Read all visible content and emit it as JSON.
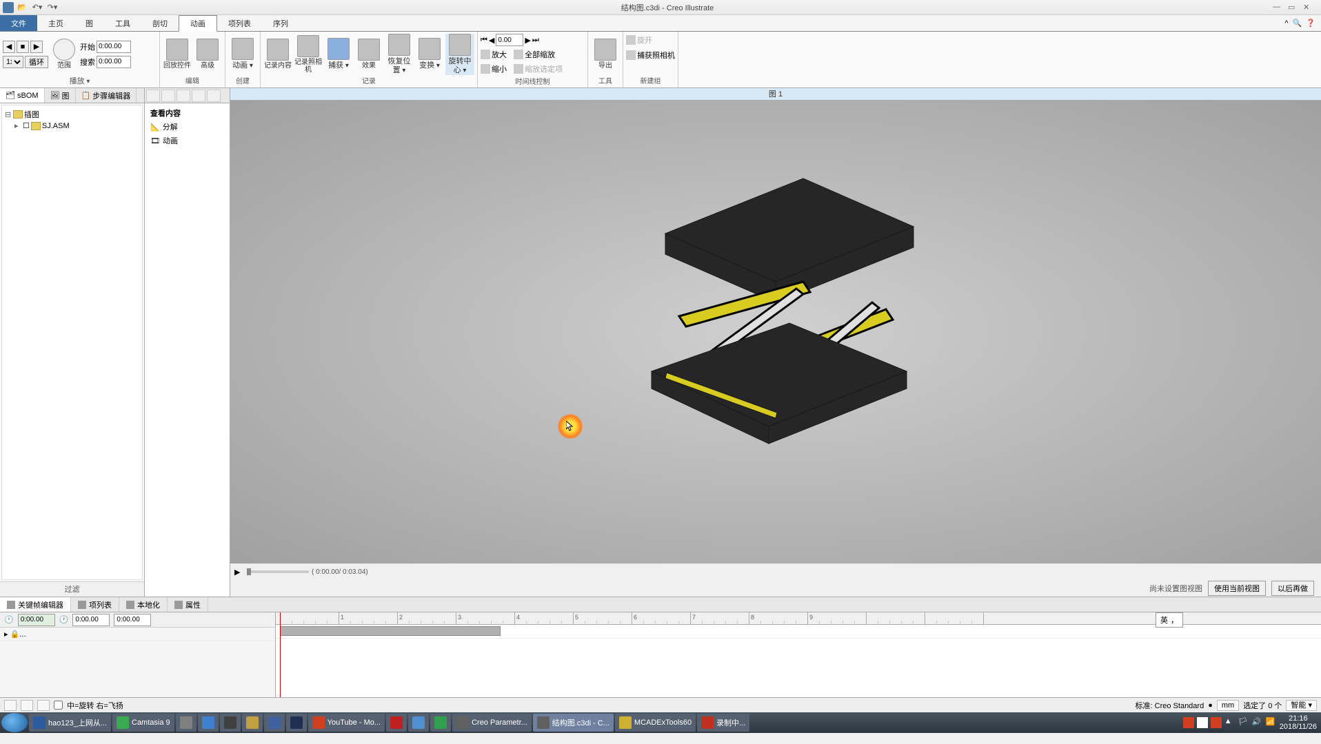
{
  "title": {
    "file": "结构图.c3di",
    "app": "Creo Illustrate"
  },
  "tabs": {
    "file": "文件",
    "home": "主页",
    "figure": "图",
    "tools": "工具",
    "section": "剖切",
    "animation": "动画",
    "itemlist": "项列表",
    "sequence": "序列"
  },
  "ribbon": {
    "playback": {
      "label": "播放",
      "range": "范围",
      "start_lbl": "开始",
      "search_lbl": "搜索",
      "start_val": "0:00.00",
      "search_val": "0:00.00",
      "speed": "1x",
      "loop": "循环"
    },
    "edit": {
      "label": "编辑",
      "controls": "回放控件",
      "advanced": "高级"
    },
    "create": {
      "label": "创建",
      "animation": "动画"
    },
    "record": {
      "label": "记录",
      "content": "记录内容",
      "camera": "记录照相机",
      "capture": "捕获",
      "effects": "效果",
      "restore": "恢复位置",
      "transform": "变换",
      "spincenter": "旋转中心"
    },
    "timeline": {
      "label": "时间线控制",
      "time": "0.00",
      "zoomin": "放大",
      "zoomout": "缩小",
      "zoomall": "全部缩放",
      "zoomselected": "缩放选定项"
    },
    "tools": {
      "label": "工具",
      "export": "导出"
    },
    "newgroup": {
      "label": "新建组",
      "roll": "旋开",
      "capturecam": "捕获照相机"
    }
  },
  "left": {
    "tabs": {
      "sbom": "sBOM",
      "figures": "图",
      "stepedit": "步骤编辑器"
    },
    "root": "插图",
    "asm": "SJ.ASM",
    "footer": "过滤"
  },
  "sec": {
    "viewcontent": "查看内容",
    "explode": "分解",
    "animation": "动画"
  },
  "viewport": {
    "title": "图 1",
    "time": "( 0:00.00/ 0:03.04)",
    "nofigview": "尚未设置图视图",
    "usecurrent": "使用当前视图",
    "later": "以后再做"
  },
  "bottom": {
    "tabs": {
      "keyframe": "关键帧编辑器",
      "itemlist": "项列表",
      "localize": "本地化",
      "props": "属性"
    },
    "t0": "0:00.00",
    "t1": "0:00.00",
    "t2": "0:00.00",
    "ruler": [
      "1",
      "2",
      "3",
      "4",
      "5",
      "6",
      "7",
      "8",
      "9"
    ],
    "ime": {
      "lang": "英",
      "punct": "，"
    }
  },
  "status": {
    "hint": "中=旋转  右=飞扬",
    "std": "标准: Creo Standard",
    "units": "mm",
    "sel": "选定了 0 个",
    "smart": "智能"
  },
  "taskbar": {
    "items": [
      {
        "label": "hao123_上网从...",
        "color": "#2a5aa0"
      },
      {
        "label": "Camtasia 9",
        "color": "#3aaa50"
      },
      {
        "label": "",
        "color": "#808080"
      },
      {
        "label": "",
        "color": "#4080d0"
      },
      {
        "label": "",
        "color": "#404040"
      },
      {
        "label": "",
        "color": "#c0a040"
      },
      {
        "label": "",
        "color": "#4060a0"
      },
      {
        "label": "",
        "color": "#203050"
      },
      {
        "label": "YouTube - Mo...",
        "color": "#d04020"
      },
      {
        "label": "",
        "color": "#c02020"
      },
      {
        "label": "",
        "color": "#5090d0"
      },
      {
        "label": "",
        "color": "#30a050"
      },
      {
        "label": "Creo Parametr...",
        "color": "#606060"
      },
      {
        "label": "结构图.c3di - C...",
        "color": "#606060",
        "active": true
      },
      {
        "label": "MCADExTools60",
        "color": "#d0b030"
      },
      {
        "label": "录制中...",
        "color": "#c03020"
      }
    ],
    "time": "21:16",
    "date": "2018/11/26"
  }
}
